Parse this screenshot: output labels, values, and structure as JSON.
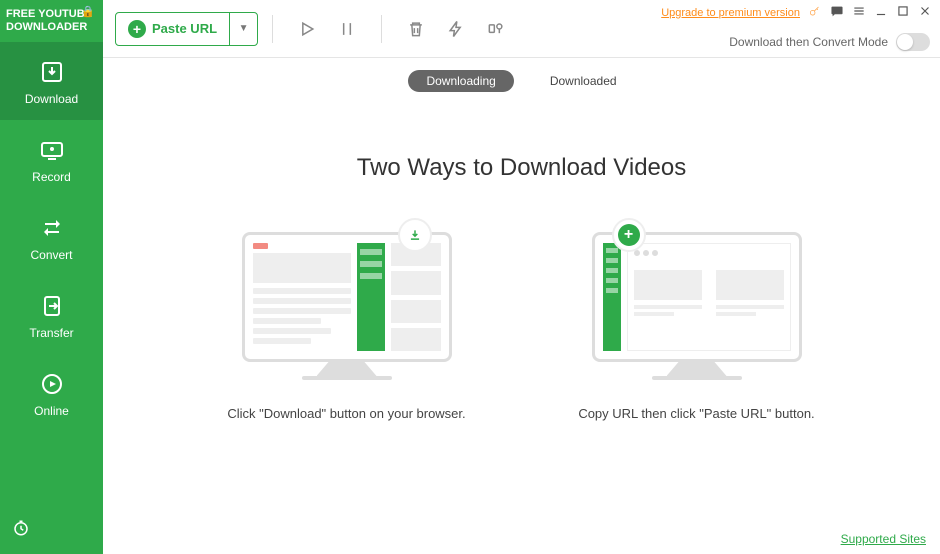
{
  "app": {
    "title": "FREE YOUTUBE DOWNLOADER"
  },
  "sidebar": {
    "items": [
      {
        "label": "Download"
      },
      {
        "label": "Record"
      },
      {
        "label": "Convert"
      },
      {
        "label": "Transfer"
      },
      {
        "label": "Online"
      }
    ]
  },
  "toolbar": {
    "paste_label": "Paste URL",
    "upgrade_label": "Upgrade to premium version",
    "mode_label": "Download then Convert Mode"
  },
  "tabs": {
    "downloading": "Downloading",
    "downloaded": "Downloaded"
  },
  "content": {
    "title": "Two Ways to Download Videos",
    "way1": "Click \"Download\" button on your browser.",
    "way2": "Copy URL then click \"Paste URL\" button."
  },
  "footer": {
    "supported": "Supported Sites"
  }
}
